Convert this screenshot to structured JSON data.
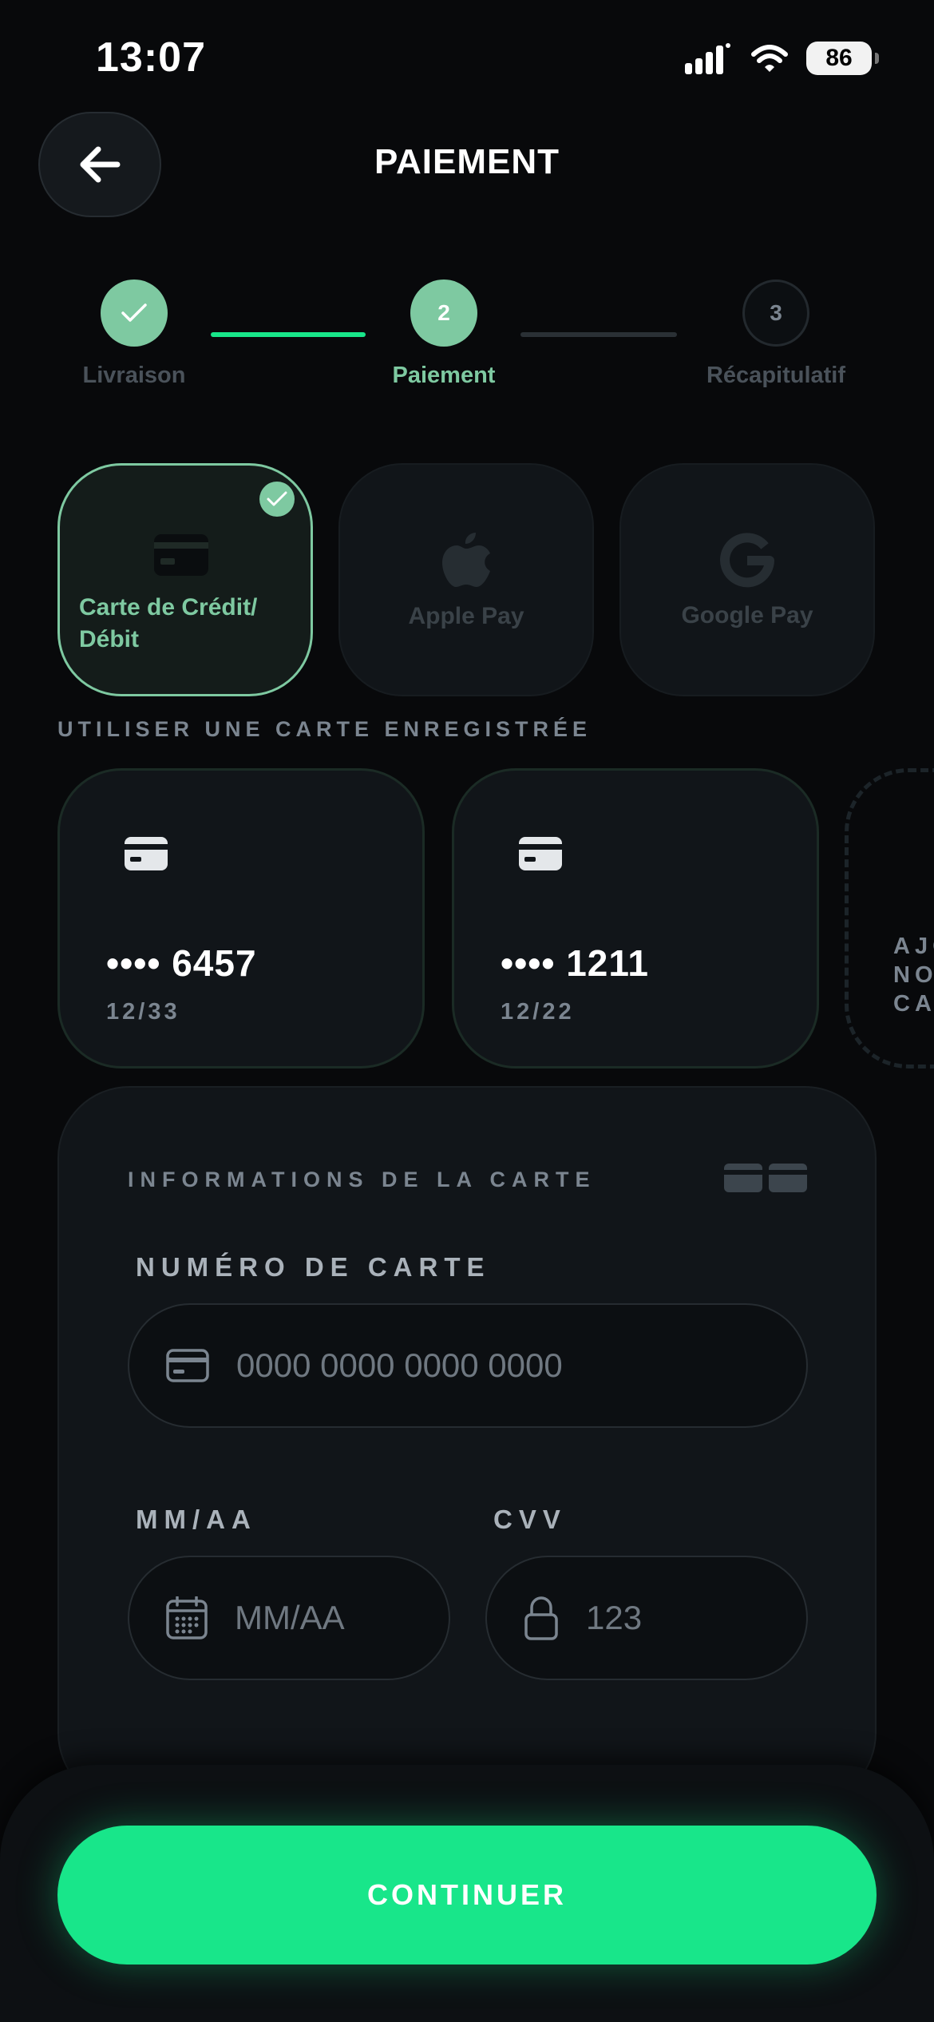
{
  "status_bar": {
    "time": "13:07",
    "battery": "86"
  },
  "header": {
    "title": "PAIEMENT"
  },
  "stepper": {
    "steps": [
      {
        "label": "Livraison",
        "state": "done",
        "number": ""
      },
      {
        "label": "Paiement",
        "state": "active",
        "number": "2"
      },
      {
        "label": "Récapitulatif",
        "state": "todo",
        "number": "3"
      }
    ]
  },
  "payment_methods": [
    {
      "label": "Carte de Crédit/ Débit",
      "icon": "credit-card-icon",
      "selected": true
    },
    {
      "label": "Apple Pay",
      "icon": "apple-icon",
      "selected": false
    },
    {
      "label": "Google Pay",
      "icon": "google-icon",
      "selected": false
    }
  ],
  "saved_cards_section": {
    "label": "UTILISER UNE CARTE ENREGISTRÉE",
    "cards": [
      {
        "number": "•••• 6457",
        "expiry": "12/33"
      },
      {
        "number": "•••• 1211",
        "expiry": "12/22"
      }
    ],
    "add_card_label": "AJO NO CA"
  },
  "card_form": {
    "title": "INFORMATIONS DE LA CARTE",
    "card_number": {
      "label": "NUMÉRO DE CARTE",
      "placeholder": "0000 0000 0000 0000"
    },
    "expiry": {
      "label": "MM/AA",
      "placeholder": "MM/AA"
    },
    "cvv": {
      "label": "CVV",
      "placeholder": "123"
    }
  },
  "footer": {
    "continue_label": "CONTINUER"
  },
  "colors": {
    "accent": "#18e68a",
    "accent_soft": "#7ec9a1",
    "background": "#08090b",
    "surface": "#111519"
  }
}
